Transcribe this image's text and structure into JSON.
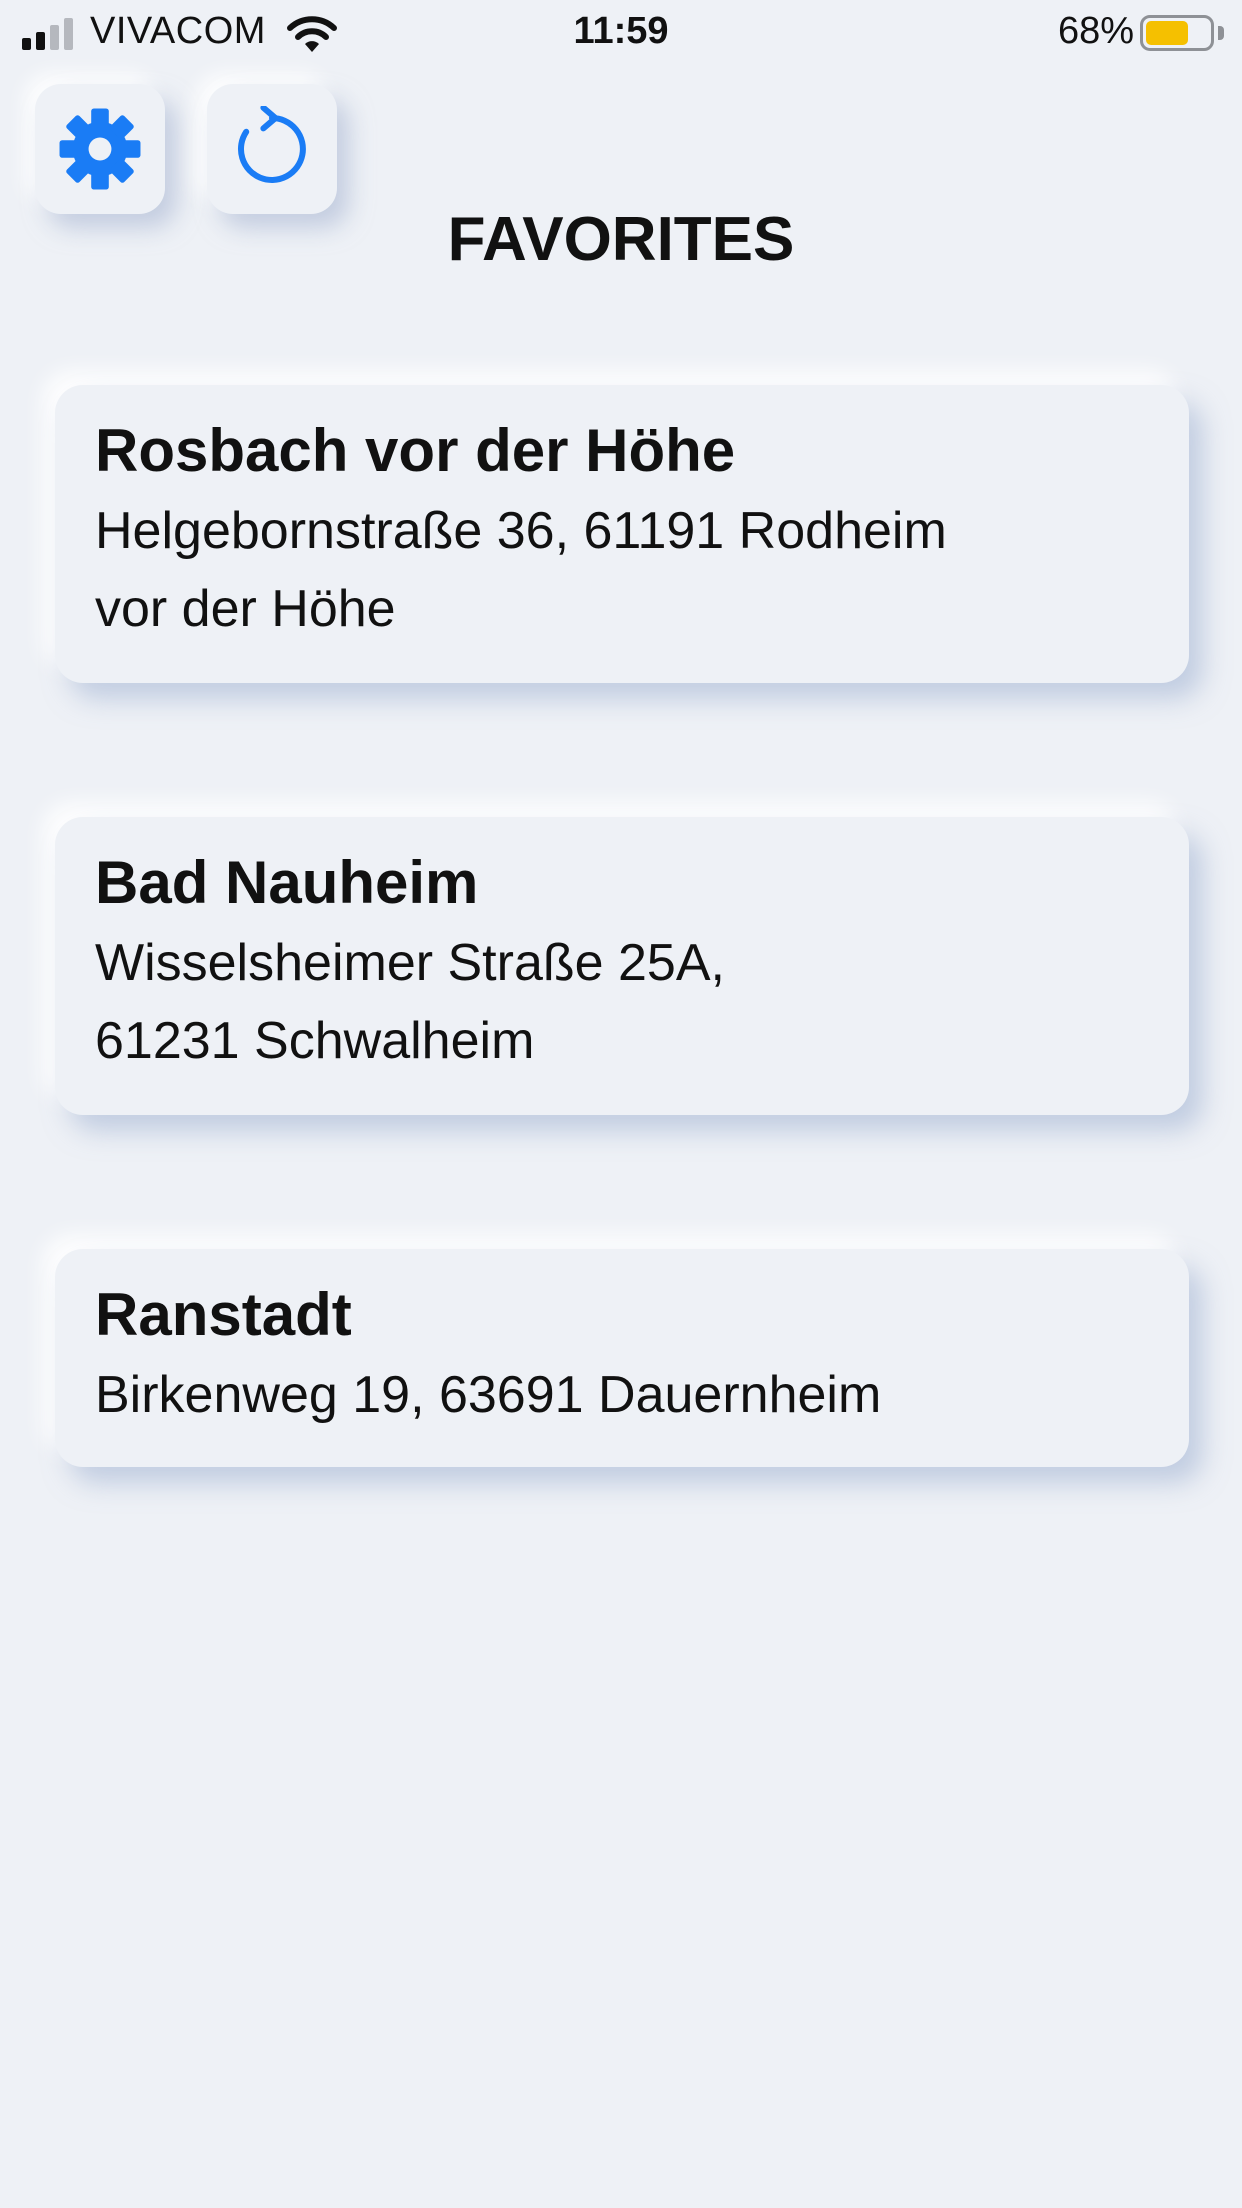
{
  "status_bar": {
    "carrier": "VIVACOM",
    "time": "11:59",
    "battery_percent": "68%",
    "battery_level": 0.68,
    "signal_bars_active": 2,
    "signal_bars_total": 4,
    "battery_color": "#f5c000"
  },
  "toolbar": {
    "settings_icon": "gear-icon",
    "refresh_icon": "refresh-icon",
    "icon_color": "#1a7cf5"
  },
  "page": {
    "title": "FAVORITES"
  },
  "favorites": [
    {
      "name": "Rosbach vor der Höhe",
      "address_line1": "Helgebornstraße 36, 61191 Rodheim",
      "address_line2": "vor der Höhe"
    },
    {
      "name": "Bad Nauheim",
      "address_line1": "Wisselsheimer Straße 25A,",
      "address_line2": "61231 Schwalheim"
    },
    {
      "name": "Ranstadt",
      "address_line1": "Birkenweg 19, 63691 Dauernheim",
      "address_line2": ""
    }
  ]
}
